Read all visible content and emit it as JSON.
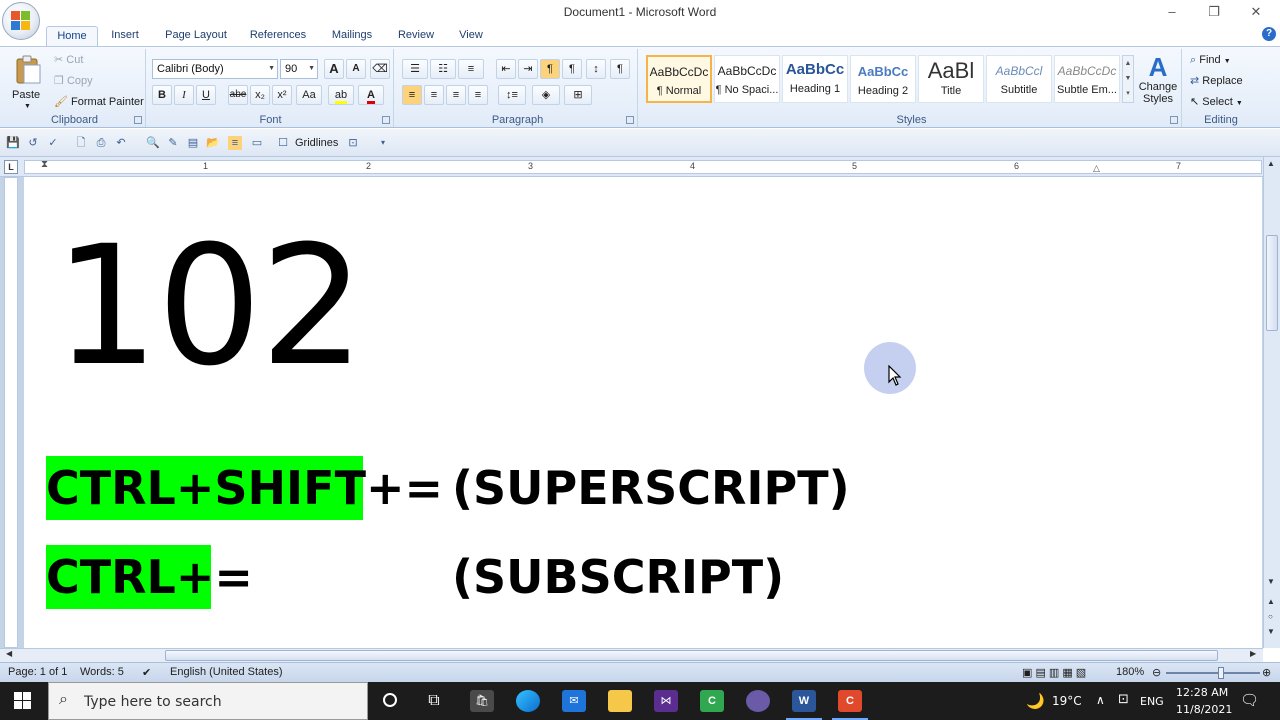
{
  "window": {
    "title": "Document1 - Microsoft Word",
    "minimize": "–",
    "maximize": "❐",
    "close": "✕"
  },
  "tabs": [
    "Home",
    "Insert",
    "Page Layout",
    "References",
    "Mailings",
    "Review",
    "View"
  ],
  "clipboard": {
    "paste": "Paste",
    "cut": "Cut",
    "copy": "Copy",
    "format_painter": "Format Painter",
    "label": "Clipboard"
  },
  "font": {
    "name": "Calibri (Body)",
    "size": "90",
    "label": "Font",
    "bold": "B",
    "italic": "I",
    "underline": "U",
    "strike": "abe",
    "subscript": "x₂",
    "superscript": "x²",
    "change_case": "Aa",
    "grow": "A",
    "shrink": "A"
  },
  "paragraph": {
    "label": "Paragraph"
  },
  "styles": {
    "label": "Styles",
    "items": [
      {
        "sample": "AaBbCcDc",
        "name": "¶ Normal"
      },
      {
        "sample": "AaBbCcDc",
        "name": "¶ No Spaci..."
      },
      {
        "sample": "AaBbCc",
        "name": "Heading 1"
      },
      {
        "sample": "AaBbCc",
        "name": "Heading 2"
      },
      {
        "sample": "AaBl",
        "name": "Title"
      },
      {
        "sample": "AaBbCcl",
        "name": "Subtitle"
      },
      {
        "sample": "AaBbCcDc",
        "name": "Subtle Em..."
      }
    ],
    "change_styles": "Change Styles"
  },
  "editing": {
    "label": "Editing",
    "find": "Find",
    "replace": "Replace",
    "select": "Select"
  },
  "qat": {
    "gridlines": "Gridlines"
  },
  "ruler": {
    "tab_selector": "L",
    "numbers": [
      "1",
      "2",
      "3",
      "4",
      "5",
      "6",
      "7"
    ]
  },
  "document": {
    "big_number": "102",
    "shortcut_1": "CTRL+SHIFT+=",
    "desc_1": "(SUPERSCRIPT)",
    "shortcut_2": "CTRL+=",
    "desc_2": "(SUBSCRIPT)",
    "highlight_color": "#00ff00"
  },
  "status": {
    "page": "Page: 1 of 1",
    "words": "Words: 5",
    "language": "English (United States)",
    "zoom": "180%"
  },
  "taskbar": {
    "search_placeholder": "Type here to search",
    "temperature": "19°C",
    "lang": "ENG",
    "time": "12:28 AM",
    "date": "11/8/2021"
  },
  "colors": {
    "ribbon_accent": "#15428b",
    "taskbar_bg": "#1c1c1c"
  }
}
